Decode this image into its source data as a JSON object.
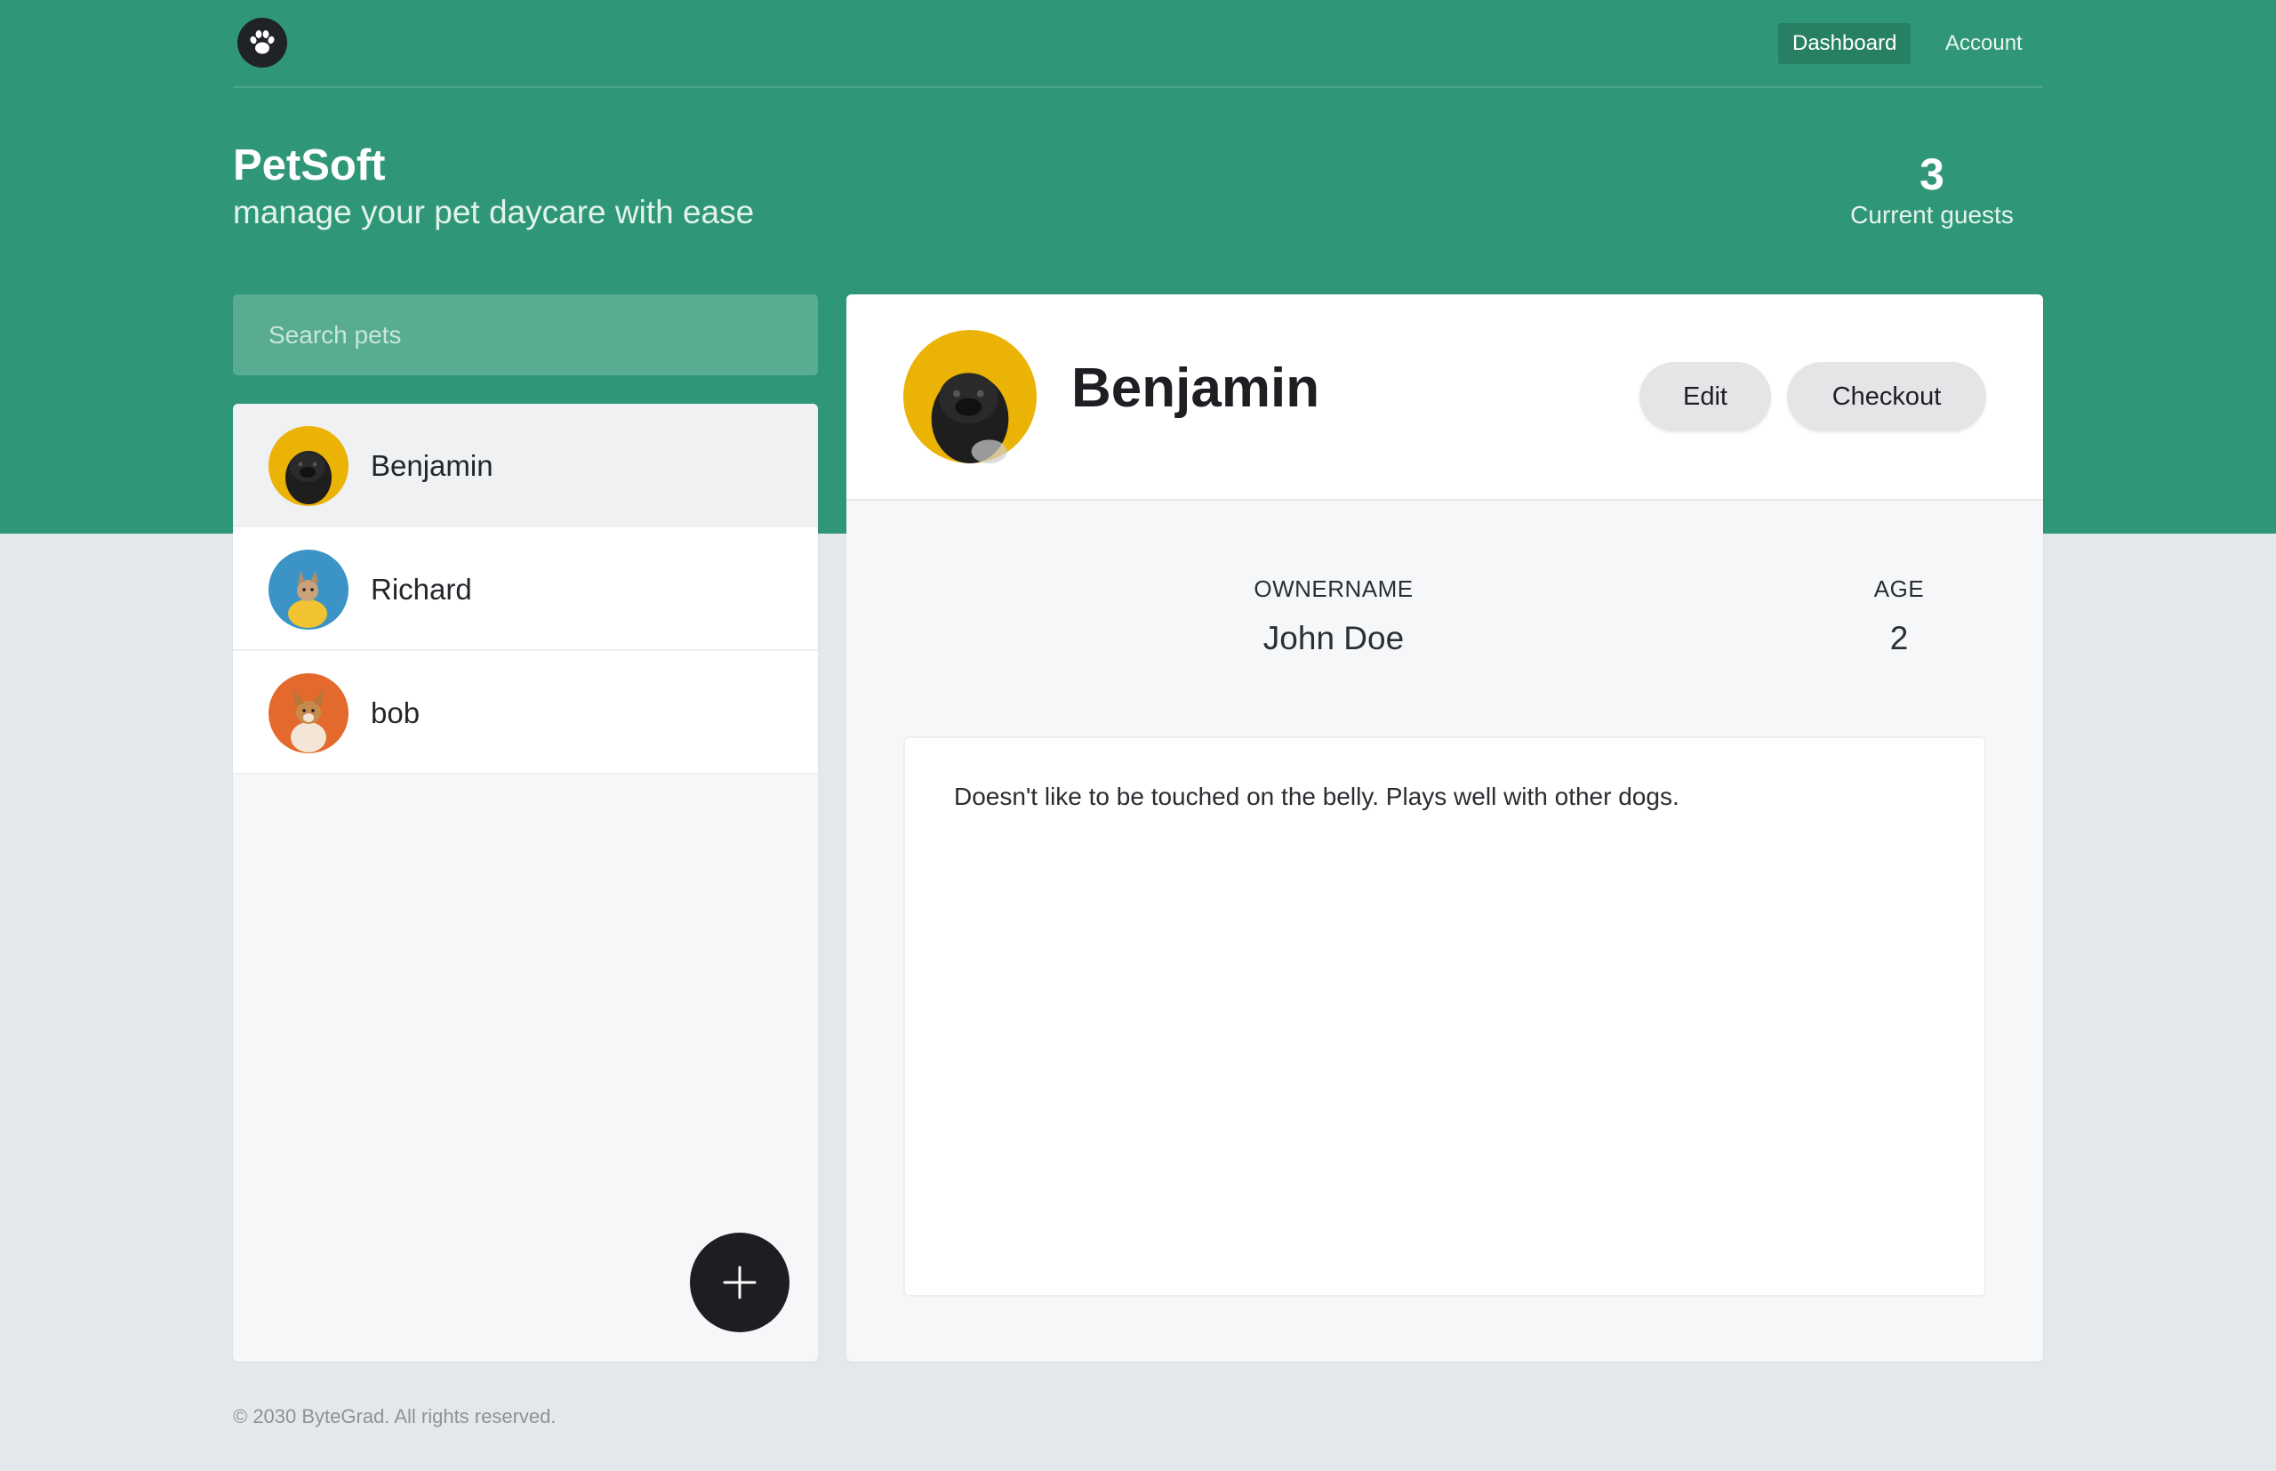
{
  "nav": {
    "logo_icon": "paw-icon",
    "links": [
      {
        "label": "Dashboard",
        "active": true
      },
      {
        "label": "Account",
        "active": false
      }
    ]
  },
  "header": {
    "title": "PetSoft",
    "subtitle": "manage your pet daycare with ease",
    "guests_count": "3",
    "guests_label": "Current guests"
  },
  "search": {
    "placeholder": "Search pets"
  },
  "pets": [
    {
      "name": "Benjamin",
      "avatar_color": "#ebb305",
      "selected": true
    },
    {
      "name": "Richard",
      "avatar_color": "#3b94c5",
      "selected": false
    },
    {
      "name": "bob",
      "avatar_color": "#e36a2c",
      "selected": false
    }
  ],
  "add_button": {
    "icon": "plus-icon"
  },
  "detail": {
    "name": "Benjamin",
    "avatar_color": "#ebb305",
    "edit_label": "Edit",
    "checkout_label": "Checkout",
    "owner_label": "OWNERNAME",
    "owner_value": "John Doe",
    "age_label": "AGE",
    "age_value": "2",
    "notes": "Doesn't like to be touched on the belly. Plays well with other dogs."
  },
  "footer": {
    "copyright": "© 2030 ByteGrad. All rights reserved."
  },
  "colors": {
    "brand_green": "#2f9777",
    "background": "#e5e8eb"
  }
}
